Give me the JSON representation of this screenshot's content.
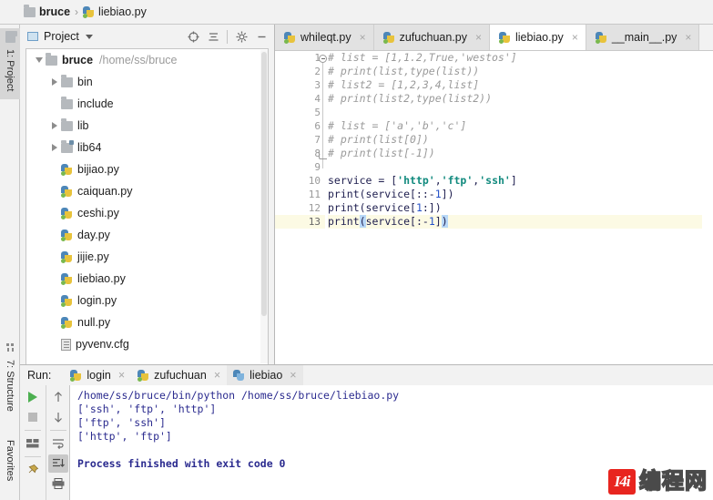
{
  "breadcrumb": {
    "project": "bruce",
    "separator": "›",
    "file": "liebiao.py"
  },
  "tool_strip": {
    "tabs": [
      {
        "label": "1: Project",
        "icon": "folder-icon",
        "active": true
      },
      {
        "label": "7: Structure",
        "icon": "structure-icon",
        "active": false
      },
      {
        "label": "Favorites",
        "icon": "",
        "active": false
      }
    ]
  },
  "project_panel": {
    "title": "Project",
    "toolbar": [
      {
        "name": "locate-icon",
        "glyph": "⊕"
      },
      {
        "name": "collapse-all-icon",
        "glyph": "≡"
      },
      {
        "name": "gear-icon",
        "glyph": "⚙"
      },
      {
        "name": "minimize-icon",
        "glyph": "—"
      }
    ],
    "tree": [
      {
        "label": "bruce",
        "path": "/home/ss/bruce",
        "icon": "folder-icon",
        "twisty": "down",
        "indent": 0,
        "bold": true
      },
      {
        "label": "bin",
        "path": "",
        "icon": "folder-icon",
        "twisty": "right",
        "indent": 1,
        "bold": false
      },
      {
        "label": "include",
        "path": "",
        "icon": "folder-icon",
        "twisty": "none",
        "indent": 1,
        "bold": false
      },
      {
        "label": "lib",
        "path": "",
        "icon": "folder-icon",
        "twisty": "right",
        "indent": 1,
        "bold": false
      },
      {
        "label": "lib64",
        "path": "",
        "icon": "folder-link-icon",
        "twisty": "right",
        "indent": 1,
        "bold": false
      },
      {
        "label": "bijiao.py",
        "path": "",
        "icon": "python-file-icon",
        "twisty": "none",
        "indent": 1,
        "bold": false
      },
      {
        "label": "caiquan.py",
        "path": "",
        "icon": "python-file-icon",
        "twisty": "none",
        "indent": 1,
        "bold": false
      },
      {
        "label": "ceshi.py",
        "path": "",
        "icon": "python-file-icon",
        "twisty": "none",
        "indent": 1,
        "bold": false
      },
      {
        "label": "day.py",
        "path": "",
        "icon": "python-file-icon",
        "twisty": "none",
        "indent": 1,
        "bold": false
      },
      {
        "label": "jijie.py",
        "path": "",
        "icon": "python-file-icon",
        "twisty": "none",
        "indent": 1,
        "bold": false
      },
      {
        "label": "liebiao.py",
        "path": "",
        "icon": "python-file-icon",
        "twisty": "none",
        "indent": 1,
        "bold": false
      },
      {
        "label": "login.py",
        "path": "",
        "icon": "python-file-icon",
        "twisty": "none",
        "indent": 1,
        "bold": false
      },
      {
        "label": "null.py",
        "path": "",
        "icon": "python-file-icon",
        "twisty": "none",
        "indent": 1,
        "bold": false
      },
      {
        "label": "pyvenv.cfg",
        "path": "",
        "icon": "config-file-icon",
        "twisty": "none",
        "indent": 1,
        "bold": false
      }
    ]
  },
  "editor": {
    "tabs": [
      {
        "label": "whileqt.py",
        "active": false,
        "close": "×"
      },
      {
        "label": "zufuchuan.py",
        "active": false,
        "close": "×"
      },
      {
        "label": "liebiao.py",
        "active": true,
        "close": "×"
      },
      {
        "label": "__main__.py",
        "active": false,
        "close": "×"
      }
    ],
    "current_line": 13,
    "lines": [
      {
        "n": 1,
        "fold": "start",
        "tokens": [
          {
            "t": "# list = [1,1.2,True,'westos']",
            "c": "cmt"
          }
        ]
      },
      {
        "n": 2,
        "fold": "",
        "tokens": [
          {
            "t": "# print(list,type(list))",
            "c": "cmt"
          }
        ]
      },
      {
        "n": 3,
        "fold": "",
        "tokens": [
          {
            "t": "# list2 = [1,2,3,4,list]",
            "c": "cmt"
          }
        ]
      },
      {
        "n": 4,
        "fold": "",
        "tokens": [
          {
            "t": "# print(list2,type(list2))",
            "c": "cmt"
          }
        ]
      },
      {
        "n": 5,
        "fold": "",
        "tokens": [
          {
            "t": "",
            "c": ""
          }
        ]
      },
      {
        "n": 6,
        "fold": "",
        "tokens": [
          {
            "t": "# list = ['a','b','c']",
            "c": "cmt"
          }
        ]
      },
      {
        "n": 7,
        "fold": "",
        "tokens": [
          {
            "t": "# print(list[0])",
            "c": "cmt"
          }
        ]
      },
      {
        "n": 8,
        "fold": "end",
        "tokens": [
          {
            "t": "# print(list[-1])",
            "c": "cmt"
          }
        ]
      },
      {
        "n": 9,
        "fold": "",
        "tokens": [
          {
            "t": "",
            "c": ""
          }
        ]
      },
      {
        "n": 10,
        "fold": "",
        "tokens": [
          {
            "t": "service = [",
            "c": ""
          },
          {
            "t": "'http'",
            "c": "str"
          },
          {
            "t": ",",
            "c": ""
          },
          {
            "t": "'ftp'",
            "c": "str"
          },
          {
            "t": ",",
            "c": ""
          },
          {
            "t": "'ssh'",
            "c": "str"
          },
          {
            "t": "]",
            "c": ""
          }
        ]
      },
      {
        "n": 11,
        "fold": "",
        "tokens": [
          {
            "t": "print(service[::-",
            "c": ""
          },
          {
            "t": "1",
            "c": "num"
          },
          {
            "t": "])",
            "c": ""
          }
        ]
      },
      {
        "n": 12,
        "fold": "",
        "tokens": [
          {
            "t": "print(service[",
            "c": ""
          },
          {
            "t": "1",
            "c": "num"
          },
          {
            "t": ":])",
            "c": ""
          }
        ]
      },
      {
        "n": 13,
        "fold": "",
        "tokens": [
          {
            "t": "print",
            "c": ""
          },
          {
            "t": "(",
            "c": "brk"
          },
          {
            "t": "service[:-",
            "c": ""
          },
          {
            "t": "1",
            "c": "num"
          },
          {
            "t": "]",
            "c": ""
          },
          {
            "t": ")",
            "c": "brk"
          }
        ]
      }
    ]
  },
  "run_panel": {
    "label": "Run:",
    "tabs": [
      {
        "label": "login",
        "active": false,
        "icon": "python-icon",
        "close": "×"
      },
      {
        "label": "zufuchuan",
        "active": false,
        "icon": "python-icon",
        "close": "×"
      },
      {
        "label": "liebiao",
        "active": true,
        "icon": "python-blue-icon",
        "close": "×"
      }
    ],
    "toolbar_left": [
      {
        "name": "run-icon",
        "active": false
      },
      {
        "name": "stop-icon",
        "active": false
      },
      {
        "name": "view-mode-icon",
        "active": false
      },
      {
        "name": "pin-icon",
        "active": false
      }
    ],
    "toolbar_right": [
      {
        "name": "arrow-up-icon",
        "active": false
      },
      {
        "name": "arrow-down-icon",
        "active": false
      },
      {
        "name": "soft-wrap-icon",
        "active": false
      },
      {
        "name": "scroll-to-end-icon",
        "active": true
      },
      {
        "name": "print-icon",
        "active": false
      }
    ],
    "console": [
      {
        "text": "/home/ss/bruce/bin/python /home/ss/bruce/liebiao.py",
        "bold": false
      },
      {
        "text": "['ssh', 'ftp', 'http']",
        "bold": false
      },
      {
        "text": "['ftp', 'ssh']",
        "bold": false
      },
      {
        "text": "['http', 'ftp']",
        "bold": false
      },
      {
        "text": "",
        "bold": false
      },
      {
        "text": "Process finished with exit code 0",
        "bold": true
      }
    ]
  },
  "watermark": {
    "logo": "I4i",
    "text": "编程网"
  },
  "colors": {
    "accent_blue": "#2552c8",
    "string_green": "#118a7e",
    "comment_gray": "#9a9a9a",
    "console_blue": "#2b2b8f",
    "current_line": "#fcfae4",
    "watermark_red": "#e8251f"
  }
}
